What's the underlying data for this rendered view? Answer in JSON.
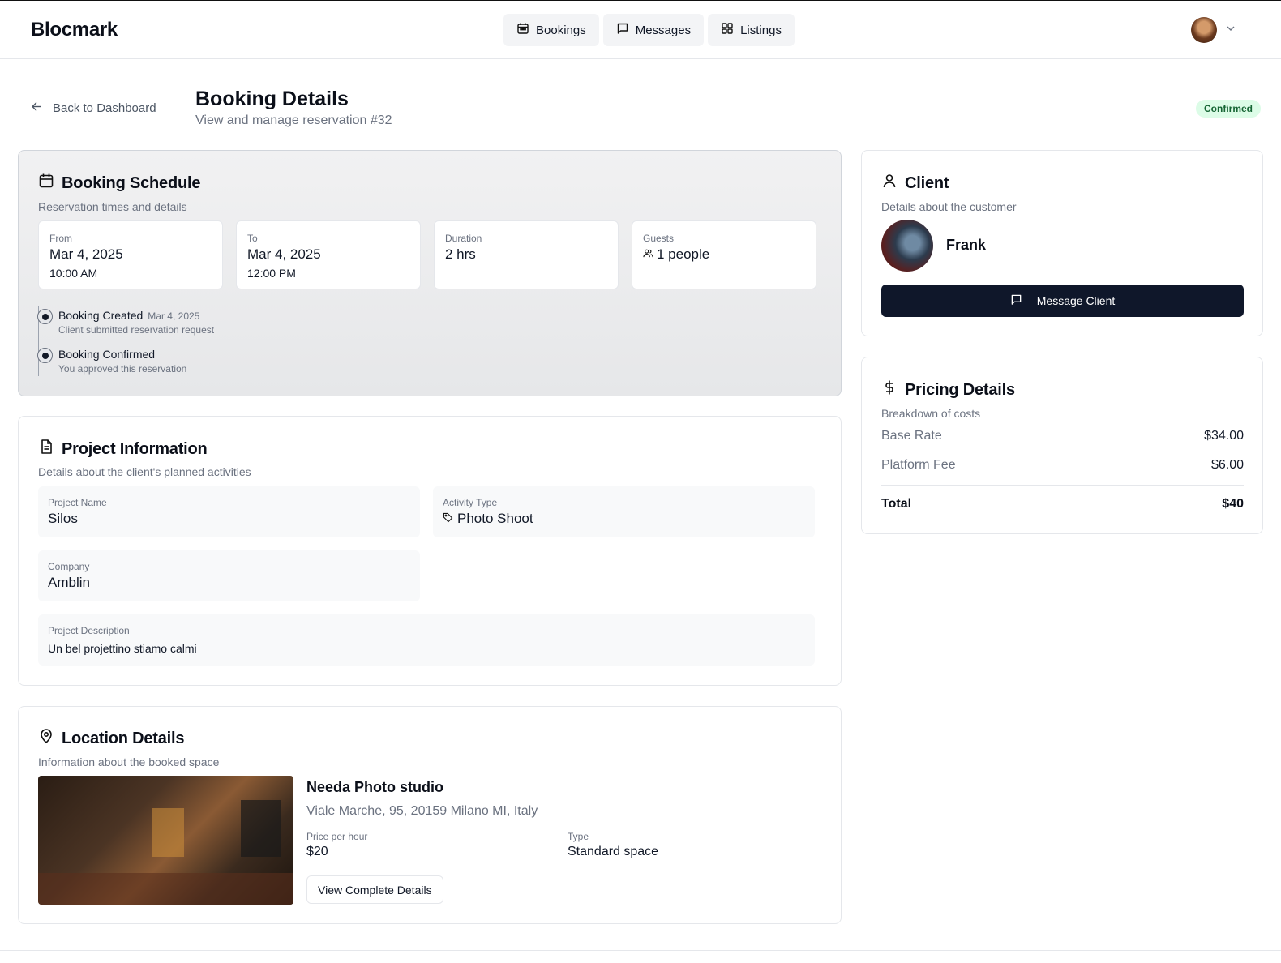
{
  "app": {
    "brand": "Blocmark"
  },
  "nav": [
    {
      "label": "Bookings",
      "icon": "calendar-icon"
    },
    {
      "label": "Messages",
      "icon": "message-icon"
    },
    {
      "label": "Listings",
      "icon": "grid-icon"
    }
  ],
  "page": {
    "back_label": "Back to Dashboard",
    "title": "Booking Details",
    "subtitle": "View and manage reservation #32",
    "status": "Confirmed",
    "status_color": "#dcfce7"
  },
  "schedule": {
    "title": "Booking Schedule",
    "description": "Reservation times and details",
    "from": {
      "label": "From",
      "date": "Mar 4, 2025",
      "time": "10:00 AM"
    },
    "to": {
      "label": "To",
      "date": "Mar 4, 2025",
      "time": "12:00 PM"
    },
    "duration": {
      "label": "Duration",
      "value": "2 hrs"
    },
    "guests": {
      "label": "Guests",
      "value": "1 people"
    },
    "timeline": [
      {
        "title": "Booking Created",
        "date": "Mar 4, 2025",
        "description": "Client submitted reservation request"
      },
      {
        "title": "Booking Confirmed",
        "date": "",
        "description": "You approved this reservation"
      }
    ]
  },
  "project": {
    "title": "Project Information",
    "description": "Details about the client's planned activities",
    "name": {
      "label": "Project Name",
      "value": "Silos"
    },
    "activity": {
      "label": "Activity Type",
      "value": "Photo Shoot"
    },
    "company": {
      "label": "Company",
      "value": "Amblin"
    },
    "project_description": {
      "label": "Project Description",
      "value": "Un bel projettino stiamo calmi"
    }
  },
  "location": {
    "title": "Location Details",
    "description": "Information about the booked space",
    "name": "Needa Photo studio",
    "address": "Viale Marche, 95, 20159 Milano MI, Italy",
    "price": {
      "label": "Price per hour",
      "value": "$20"
    },
    "type": {
      "label": "Type",
      "value": "Standard space"
    },
    "details_button": "View Complete Details"
  },
  "client": {
    "title": "Client",
    "description": "Details about the customer",
    "name": "Frank",
    "message_button": "Message Client"
  },
  "pricing": {
    "title": "Pricing Details",
    "description": "Breakdown of costs",
    "rows": [
      {
        "label": "Base Rate",
        "value": "$34.00"
      },
      {
        "label": "Platform Fee",
        "value": "$6.00"
      }
    ],
    "total": {
      "label": "Total",
      "value": "$40"
    }
  }
}
